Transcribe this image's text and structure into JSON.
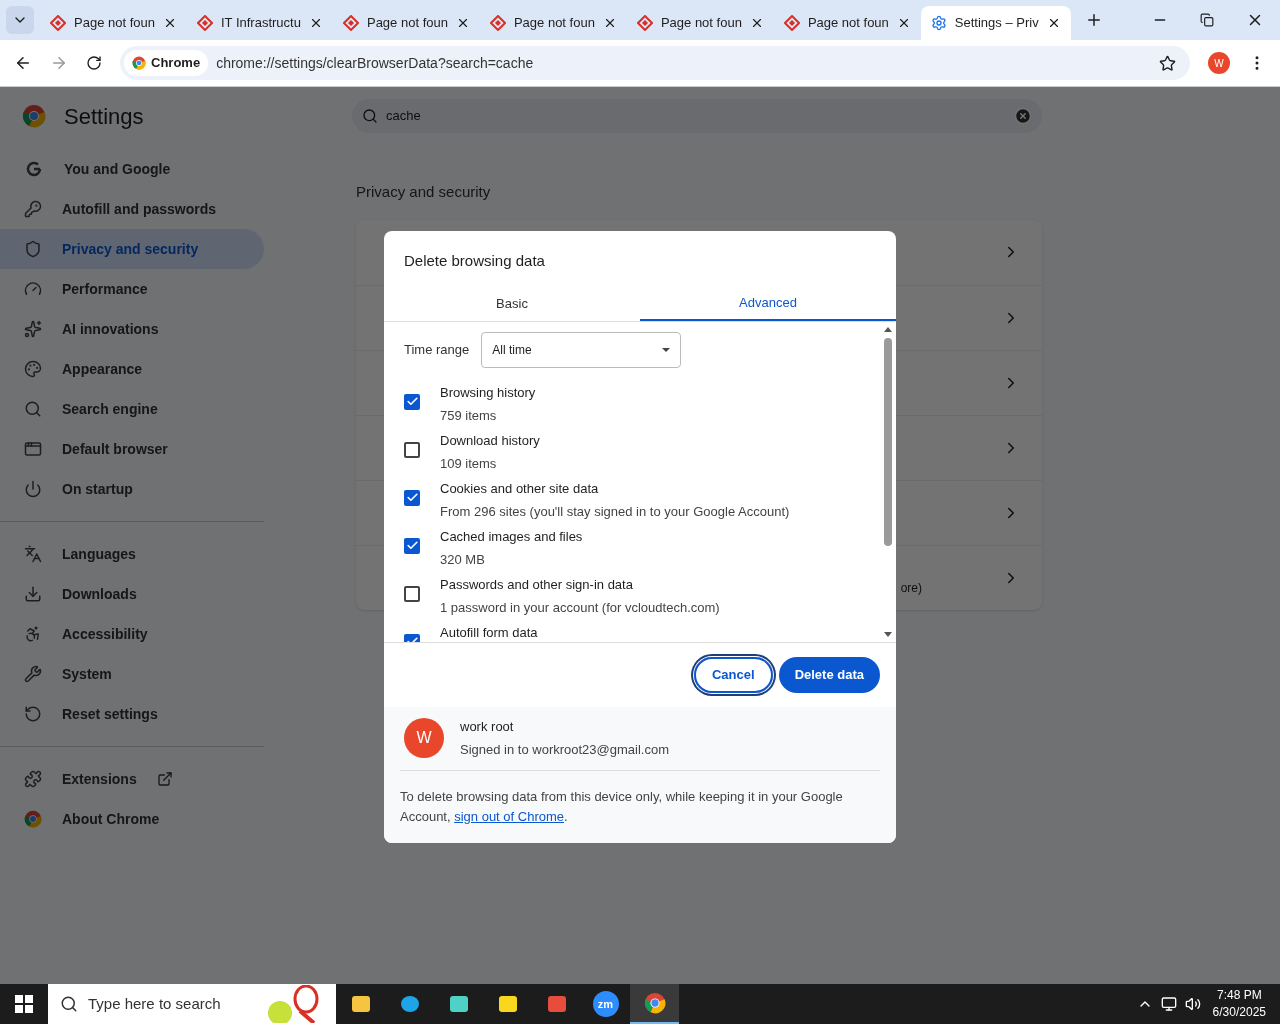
{
  "browser": {
    "tabs": [
      {
        "title": "Page not foun",
        "selected": false
      },
      {
        "title": "IT Infrastructu",
        "selected": false
      },
      {
        "title": "Page not foun",
        "selected": false
      },
      {
        "title": "Page not foun",
        "selected": false
      },
      {
        "title": "Page not foun",
        "selected": false
      },
      {
        "title": "Page not foun",
        "selected": false
      },
      {
        "title": "Settings – Priv",
        "selected": true
      }
    ],
    "site_chip": "Chrome",
    "url": "chrome://settings/clearBrowserData?search=cache",
    "profile_initial": "W"
  },
  "settings": {
    "title": "Settings",
    "search_value": "cache",
    "sidebar": [
      [
        {
          "label": "You and Google",
          "selected": false
        },
        {
          "label": "Autofill and passwords",
          "selected": false
        },
        {
          "label": "Privacy and security",
          "selected": true
        },
        {
          "label": "Performance",
          "selected": false
        },
        {
          "label": "AI innovations",
          "selected": false
        },
        {
          "label": "Appearance",
          "selected": false
        },
        {
          "label": "Search engine",
          "selected": false
        },
        {
          "label": "Default browser",
          "selected": false
        },
        {
          "label": "On startup",
          "selected": false
        }
      ],
      [
        {
          "label": "Languages",
          "selected": false
        },
        {
          "label": "Downloads",
          "selected": false
        },
        {
          "label": "Accessibility",
          "selected": false
        },
        {
          "label": "System",
          "selected": false
        },
        {
          "label": "Reset settings",
          "selected": false
        }
      ],
      [
        {
          "label": "Extensions",
          "selected": false
        },
        {
          "label": "About Chrome",
          "selected": false
        }
      ]
    ],
    "section_title": "Privacy and security",
    "card_rows": [
      "",
      "",
      "",
      "",
      "",
      "ore)"
    ]
  },
  "dialog": {
    "title": "Delete browsing data",
    "tabs": [
      {
        "label": "Basic",
        "selected": false
      },
      {
        "label": "Advanced",
        "selected": true
      }
    ],
    "time_range_label": "Time range",
    "time_range_value": "All time",
    "options": [
      {
        "title": "Browsing history",
        "detail": "759 items",
        "checked": true
      },
      {
        "title": "Download history",
        "detail": "109 items",
        "checked": false
      },
      {
        "title": "Cookies and other site data",
        "detail": "From 296 sites (you'll stay signed in to your Google Account)",
        "checked": true
      },
      {
        "title": "Cached images and files",
        "detail": "320 MB",
        "checked": true
      },
      {
        "title": "Passwords and other sign-in data",
        "detail": "1 password in your account (for vcloudtech.com)",
        "checked": false
      },
      {
        "title": "Autofill form data",
        "checked": true
      }
    ],
    "buttons": [
      "Cancel",
      "Delete data"
    ],
    "account": {
      "initial": "W",
      "name": "work root",
      "status": "Signed in to workroot23@gmail.com"
    },
    "footer": {
      "before": "To delete browsing data from this device only, while keeping it in your Google Account, ",
      "link": "sign out of Chrome",
      "after": "."
    }
  },
  "taskbar": {
    "search_placeholder": "Type here to search",
    "zoom_label": "zm",
    "time": "7:48 PM",
    "date": "6/30/2025"
  }
}
